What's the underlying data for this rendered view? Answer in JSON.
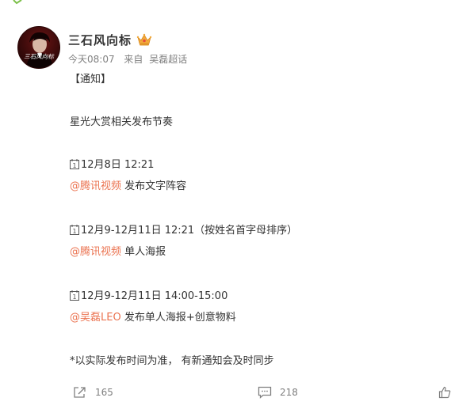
{
  "post": {
    "author": "三石风向标",
    "time": "今天08:07",
    "source_prefix": "来自",
    "source": "吴磊超话",
    "avatar_caption": "三石风向标"
  },
  "content": {
    "notice": "【通知】",
    "headline": "星光大赏相关发布节奏",
    "items": [
      {
        "date": "12月8日 12:21",
        "mention": "@腾讯视频",
        "desc": " 发布文字阵容"
      },
      {
        "date": "12月9-12月11日 12:21（按姓名首字母排序）",
        "mention": "@腾讯视频",
        "desc": " 单人海报"
      },
      {
        "date": "12月9-12月11日 14:00-15:00",
        "mention": "@吴磊LEO",
        "desc": " 发布单人海报+创意物料"
      }
    ],
    "footnote": "*以实际发布时间为准， 有新通知会及时同步"
  },
  "actions": {
    "repost_count": "165",
    "comment_count": "218"
  },
  "colors": {
    "mention": "#eb7350",
    "meta": "#808080",
    "text": "#333333"
  }
}
